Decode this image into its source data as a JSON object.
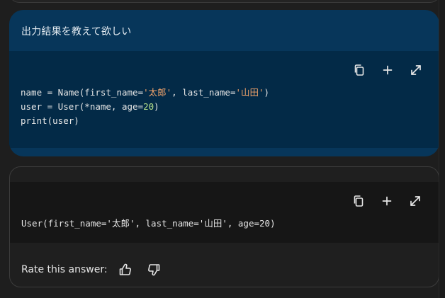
{
  "user_message": {
    "prompt": "出力結果を教えて欲しい",
    "code": {
      "line1": {
        "a": "name = Name(first_name=",
        "s1": "'太郎'",
        "b": ", last_name=",
        "s2": "'山田'",
        "c": ")"
      },
      "line2": {
        "a": "user = User(*name, age=",
        "n1": "20",
        "b": ")"
      },
      "line3": "print(user)"
    }
  },
  "answer": {
    "code": {
      "a": "User(first_name=",
      "s1": "'太郎'",
      "b": ", last_name=",
      "s2": "'山田'",
      "c": ", age=20)"
    },
    "rate_label": "Rate this answer:"
  },
  "toolbar_icons": [
    "copy-icon",
    "plus-icon",
    "expand-icon"
  ],
  "colors": {
    "user_card": "#07365a",
    "user_code_bg": "#032a47",
    "answer_code_bg": "#161616",
    "string": "#f1a36b",
    "number": "#b5e08a"
  }
}
